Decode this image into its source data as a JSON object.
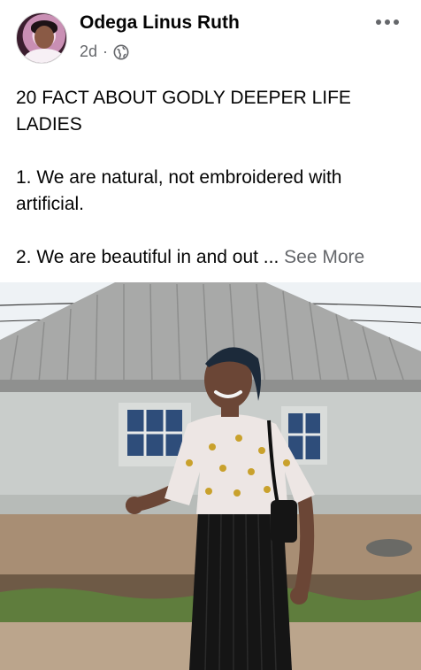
{
  "post": {
    "author_name": "Odega Linus Ruth",
    "timestamp": "2d",
    "separator": "·",
    "privacy_icon": "globe-icon",
    "more_icon": "more-horizontal-icon",
    "title_line": "20 FACT ABOUT GODLY DEEPER LIFE LADIES",
    "fact_1": "1. We are natural, not embroidered with artificial.",
    "fact_2": "2. We are beautiful in and out ...",
    "see_more": "See More"
  },
  "colors": {
    "text_primary": "#050505",
    "text_secondary": "#65676b"
  }
}
